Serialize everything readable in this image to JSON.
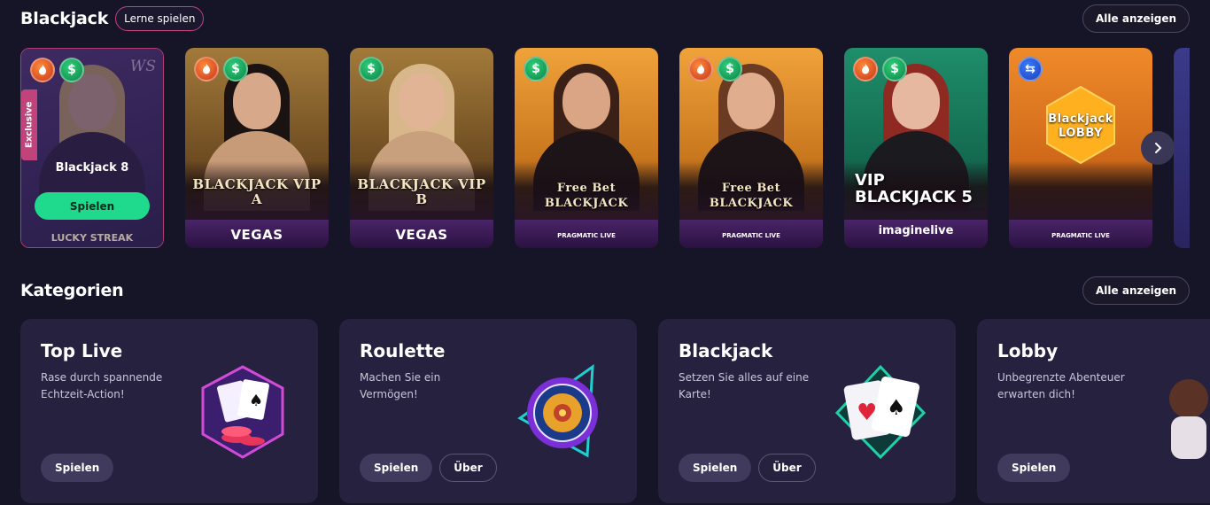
{
  "blackjack_section": {
    "title": "Blackjack",
    "learn_label": "Lerne spielen",
    "show_all_label": "Alle anzeigen"
  },
  "tiles": [
    {
      "name": "Blackjack 8",
      "exclusive_label": "Exclusive",
      "play_label": "Spielen",
      "watermark": "WS",
      "provider": "LUCKY STREAK",
      "badges": [
        "fire-icon",
        "cash-icon"
      ]
    },
    {
      "logo": "BLACKJACK VIP A",
      "provider": "VEGAS",
      "badges": [
        "fire-icon",
        "cash-icon"
      ]
    },
    {
      "logo": "BLACKJACK VIP B",
      "provider": "VEGAS",
      "badges": [
        "cash-icon"
      ]
    },
    {
      "logo": "Free Bet BLACKJACK",
      "provider": "PRAGMATIC LIVE",
      "badges": [
        "cash-icon"
      ]
    },
    {
      "logo": "Free Bet BLACKJACK",
      "provider": "PRAGMATIC LIVE",
      "badges": [
        "fire-icon",
        "cash-icon"
      ]
    },
    {
      "logo": "VIP BLACKJACK 5",
      "provider": "imaginelive",
      "badges": [
        "fire-icon",
        "cash-icon"
      ]
    },
    {
      "logo": "Blackjack LOBBY",
      "provider": "PRAGMATIC LIVE",
      "badges": [
        "swap-icon"
      ]
    }
  ],
  "categories_section": {
    "title": "Kategorien",
    "show_all_label": "Alle anzeigen"
  },
  "categories": [
    {
      "title": "Top Live",
      "desc": "Rase durch spannende Echtzeit-Action!",
      "play_label": "Spielen"
    },
    {
      "title": "Roulette",
      "desc": "Machen Sie ein Vermögen!",
      "play_label": "Spielen",
      "about_label": "Über"
    },
    {
      "title": "Blackjack",
      "desc": "Setzen Sie alles auf eine Karte!",
      "play_label": "Spielen",
      "about_label": "Über"
    },
    {
      "title": "Lobby",
      "desc": "Unbegrenzte Abenteuer erwarten dich!",
      "play_label": "Spielen"
    }
  ],
  "colors": {
    "background": "#161427",
    "card": "#25213e",
    "play_green": "#1fd98c",
    "accent_pink": "#c0437c"
  }
}
